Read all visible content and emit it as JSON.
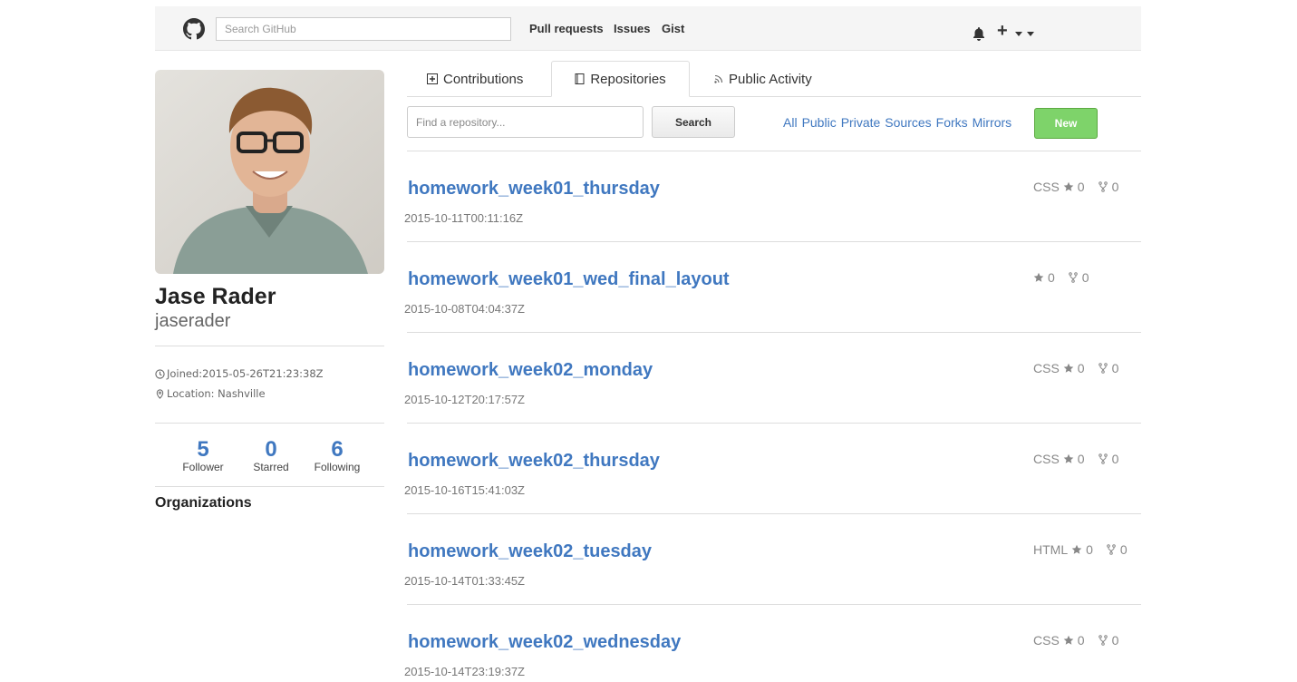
{
  "header": {
    "search_placeholder": "Search GitHub",
    "nav": [
      "Pull requests",
      "Issues",
      "Gist"
    ],
    "icons": [
      "github-logo-icon",
      "bell-icon",
      "plus-icon",
      "caret-down-icon"
    ]
  },
  "profile": {
    "name": "Jase Rader",
    "login": "jaserader",
    "joined": "Joined:2015-05-26T21:23:38Z",
    "location": "Location: Nashville",
    "stats": [
      {
        "num": "5",
        "label": "Follower"
      },
      {
        "num": "0",
        "label": "Starred"
      },
      {
        "num": "6",
        "label": "Following"
      }
    ],
    "organizations_heading": "Organizations"
  },
  "tabs": [
    {
      "label": "Contributions",
      "icon": "plus-square-icon"
    },
    {
      "label": "Repositories",
      "icon": "book-icon"
    },
    {
      "label": "Public Activity",
      "icon": "rss-icon"
    }
  ],
  "repo_controls": {
    "find_placeholder": "Find a repository...",
    "search_label": "Search",
    "filters": [
      "All",
      "Public",
      "Private",
      "Sources",
      "Forks",
      "Mirrors"
    ],
    "new_label": "New"
  },
  "repos": [
    {
      "name": "homework_week01_thursday",
      "date": "2015-10-11T00:11:16Z",
      "lang": "CSS",
      "stars": "0",
      "forks": "0"
    },
    {
      "name": "homework_week01_wed_final_layout",
      "date": "2015-10-08T04:04:37Z",
      "lang": "",
      "stars": "0",
      "forks": "0"
    },
    {
      "name": "homework_week02_monday",
      "date": "2015-10-12T20:17:57Z",
      "lang": "CSS",
      "stars": "0",
      "forks": "0"
    },
    {
      "name": "homework_week02_thursday",
      "date": "2015-10-16T15:41:03Z",
      "lang": "CSS",
      "stars": "0",
      "forks": "0"
    },
    {
      "name": "homework_week02_tuesday",
      "date": "2015-10-14T01:33:45Z",
      "lang": "HTML",
      "stars": "0",
      "forks": "0"
    },
    {
      "name": "homework_week02_wednesday",
      "date": "2015-10-14T23:19:37Z",
      "lang": "CSS",
      "stars": "0",
      "forks": "0"
    }
  ],
  "colors": {
    "link": "#4078c0",
    "new_button": "#7ed36a"
  }
}
